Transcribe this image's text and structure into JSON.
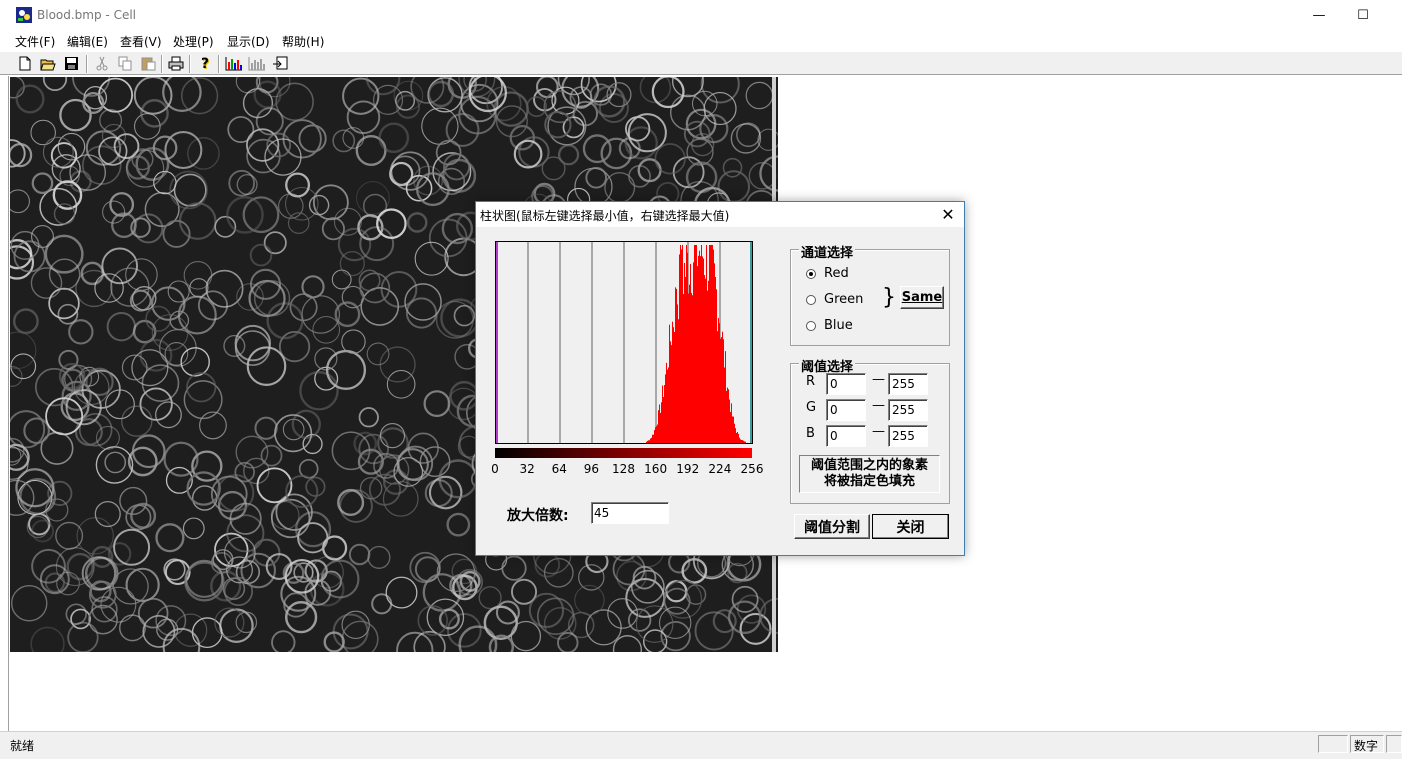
{
  "window": {
    "title": "Blood.bmp - Cell",
    "minimize_glyph": "—",
    "maximize_glyph": "☐"
  },
  "menu": [
    "文件(F)",
    "编辑(E)",
    "查看(V)",
    "处理(P)",
    "显示(D)",
    "帮助(H)"
  ],
  "toolbar": {
    "buttons": [
      "new-file-icon",
      "open-folder-icon",
      "save-icon",
      "cut-icon",
      "copy-icon",
      "paste-icon",
      "print-icon",
      "help-icon",
      "histogram-icon",
      "histogram-disabled-icon",
      "export-icon"
    ],
    "help_glyph": "?"
  },
  "status": {
    "text": "就绪",
    "pane_numlock": "数字"
  },
  "dialog": {
    "title": "柱状图(鼠标左键选择最小值，右键选择最大值)",
    "close_glyph": "✕",
    "x_ticks": [
      "0",
      "32",
      "64",
      "96",
      "128",
      "160",
      "192",
      "224",
      "256"
    ],
    "zoom_label": "放大倍数:",
    "zoom_value": "45",
    "channel_group": {
      "legend": "通道选择",
      "options": [
        "Red",
        "Green",
        "Blue"
      ],
      "selected": "Red",
      "brace": "}",
      "same_button": "Same"
    },
    "threshold_group": {
      "legend": "阈值选择",
      "rows": [
        {
          "label": "R",
          "min": "0",
          "max": "255"
        },
        {
          "label": "G",
          "min": "0",
          "max": "255"
        },
        {
          "label": "B",
          "min": "0",
          "max": "255"
        }
      ],
      "dash": "—",
      "note_line1": "阈值范围之内的象素",
      "note_line2": "将被指定色填充"
    },
    "segment_button": "阈值分割",
    "close_button": "关闭"
  },
  "colors": {
    "histogram_bar": "#ff0000",
    "min_marker": "#a000c0",
    "max_marker": "#008080",
    "dialog_border": "#3c7fb1"
  }
}
